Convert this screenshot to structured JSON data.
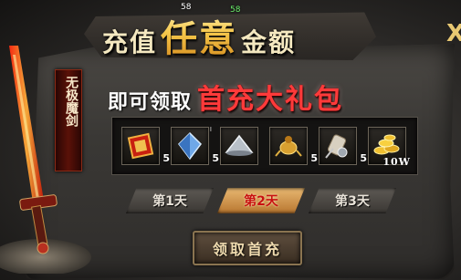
{
  "header": {
    "title_part1": "充值",
    "title_emphasis": "任意",
    "title_part2": "金额",
    "hud_left": "58",
    "hud_right": "58",
    "close_label": "X"
  },
  "subtitle": {
    "prefix": "即可领取",
    "highlight": "首充大礼包"
  },
  "weapon": {
    "name": "无极魔剑"
  },
  "rewards": [
    {
      "icon": "red-scroll-icon",
      "qty": "5"
    },
    {
      "icon": "blue-crystal-icon",
      "qty": "5",
      "badge": "I"
    },
    {
      "icon": "conical-hat-icon",
      "qty": ""
    },
    {
      "icon": "golden-bug-icon",
      "qty": "5"
    },
    {
      "icon": "scroll-bundle-icon",
      "qty": "5"
    },
    {
      "icon": "gold-coins-icon",
      "qty": "10W"
    }
  ],
  "tabs": [
    {
      "label": "第1天",
      "active": false
    },
    {
      "label": "第2天",
      "active": true
    },
    {
      "label": "第3天",
      "active": false
    }
  ],
  "claim_button": {
    "label": "领取首充"
  },
  "colors": {
    "accent_gold": "#f5c64a",
    "accent_red": "#ff3a3a",
    "active_tab": "#c81010"
  }
}
